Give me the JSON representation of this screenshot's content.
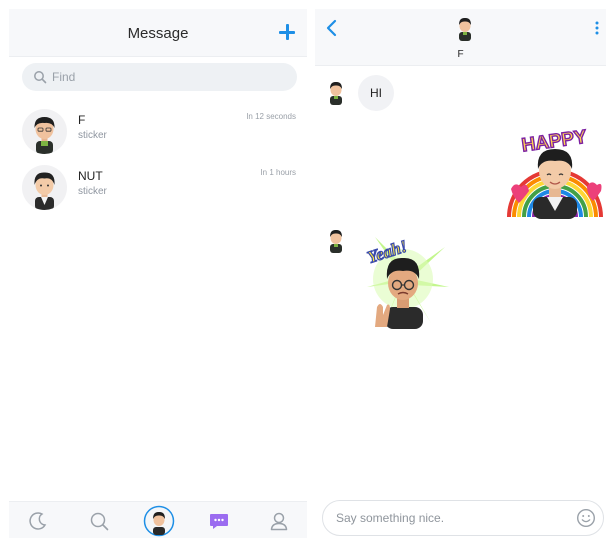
{
  "message_list": {
    "title": "Message",
    "search": {
      "placeholder": "Find"
    },
    "conversations": [
      {
        "name": "F",
        "preview": "sticker",
        "time": "In 12 seconds"
      },
      {
        "name": "NUT",
        "preview": "sticker",
        "time": "In 1 hours"
      }
    ],
    "nav": [
      "moon-icon",
      "search-icon",
      "avatar-icon",
      "chat-bubble-icon",
      "profile-icon"
    ]
  },
  "chat": {
    "contact_name": "F",
    "messages": [
      {
        "from": "contact",
        "kind": "text",
        "text": "HI"
      },
      {
        "from": "me",
        "kind": "sticker",
        "text": "HAPPY"
      },
      {
        "from": "contact",
        "kind": "sticker",
        "text": "Yeah!"
      }
    ],
    "composer": {
      "placeholder": "Say something nice."
    }
  },
  "colors": {
    "accent": "#1e8fe6",
    "chat_nav_active": "#9b6cf0",
    "header_bg": "#f7f8fa"
  }
}
